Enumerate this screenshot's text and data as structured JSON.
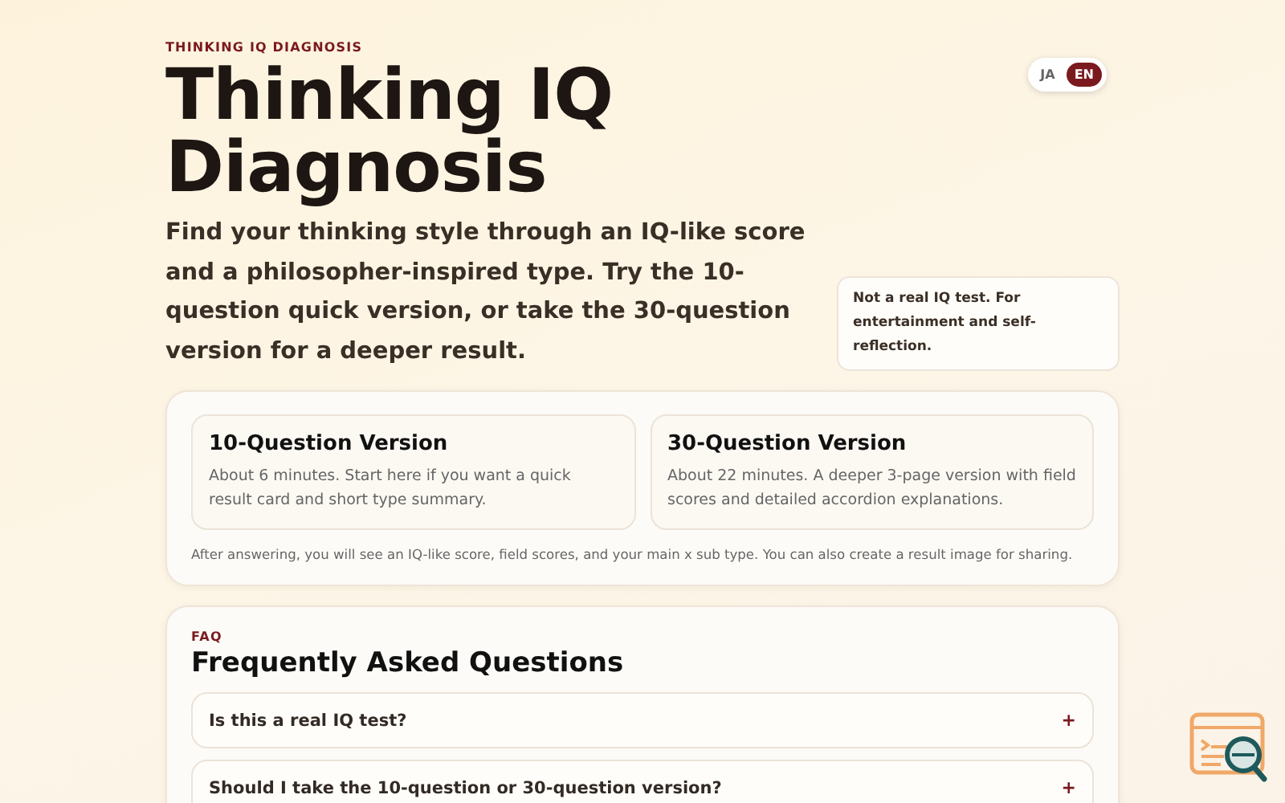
{
  "hero": {
    "eyebrow": "THINKING IQ DIAGNOSIS",
    "title": "Thinking IQ Diagnosis",
    "lead": "Find your thinking style through an IQ-like score and a philosopher-inspired type. Try the 10-question quick version, or take the 30-question version for a deeper result.",
    "languages": [
      {
        "label": "JA",
        "selected": false
      },
      {
        "label": "EN",
        "selected": true
      }
    ],
    "note": "Not a real IQ test. For entertainment and self-reflection."
  },
  "versions": {
    "cards": [
      {
        "title": "10-Question Version",
        "description": "About 6 minutes. Start here if you want a quick result card and short type summary."
      },
      {
        "title": "30-Question Version",
        "description": "About 22 minutes. A deeper 3-page version with field scores and detailed accordion explanations."
      }
    ],
    "footnote": "After answering, you will see an IQ-like score, field scores, and your main x sub type. You can also create a result image for sharing."
  },
  "faq": {
    "eyebrow": "FAQ",
    "title": "Frequently Asked Questions",
    "items": [
      {
        "question": "Is this a real IQ test?",
        "toggle": "+"
      },
      {
        "question": "Should I take the 10-question or 30-question version?",
        "toggle": "+"
      }
    ]
  }
}
